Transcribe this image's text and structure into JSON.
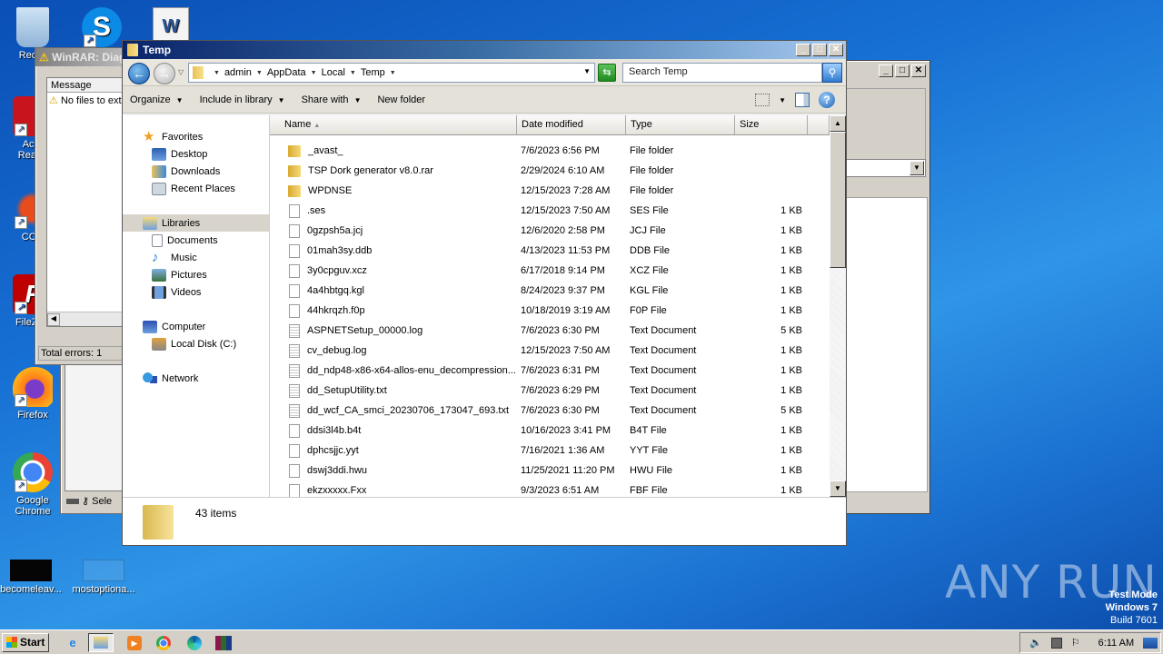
{
  "desktop": {
    "icons": [
      {
        "label": "Recycle Bin",
        "visible_label": "Recyc"
      },
      {
        "label": "Skype"
      },
      {
        "label": "Word Document"
      },
      {
        "label": "Acrobat Reader",
        "visible_label": "Acro\nReade"
      },
      {
        "label": "CCleaner",
        "visible_label": "CCle"
      },
      {
        "label": "FileZilla",
        "visible_label": "FileZilla"
      },
      {
        "label": "Firefox"
      },
      {
        "label": "Google Chrome"
      },
      {
        "label": "becomeleav..."
      },
      {
        "label": "mostoptiona..."
      }
    ],
    "watermark": "ANY RUN",
    "test_mode": {
      "line1": "Test Mode",
      "line2": "Windows 7",
      "line3": "Build 7601"
    }
  },
  "winrar_dialog": {
    "title": "WinRAR: Diagnostic messages",
    "visible_title": "WinRAR: Diag",
    "column_header": "Message",
    "messages": [
      {
        "icon": "warning-icon",
        "text": "No files to extract"
      }
    ],
    "status": "Total errors: 1"
  },
  "winrar_main": {
    "status_label": "Sele"
  },
  "explorer": {
    "title": "Temp",
    "breadcrumb": [
      "admin",
      "AppData",
      "Local",
      "Temp"
    ],
    "search_placeholder": "Search Temp",
    "toolbar": {
      "organize": "Organize",
      "include_in_library": "Include in library",
      "share_with": "Share with",
      "new_folder": "New folder"
    },
    "nav": {
      "favorites": {
        "label": "Favorites",
        "items": [
          "Desktop",
          "Downloads",
          "Recent Places"
        ]
      },
      "libraries": {
        "label": "Libraries",
        "items": [
          "Documents",
          "Music",
          "Pictures",
          "Videos"
        ]
      },
      "computer": {
        "label": "Computer",
        "items": [
          "Local Disk (C:)"
        ]
      },
      "network": {
        "label": "Network"
      }
    },
    "columns": {
      "name": "Name",
      "date": "Date modified",
      "type": "Type",
      "size": "Size"
    },
    "files": [
      {
        "name": "_avast_",
        "date": "7/6/2023 6:56 PM",
        "type": "File folder",
        "size": "",
        "kind": "folder"
      },
      {
        "name": "TSP Dork generator v8.0.rar",
        "date": "2/29/2024 6:10 AM",
        "type": "File folder",
        "size": "",
        "kind": "folder"
      },
      {
        "name": "WPDNSE",
        "date": "12/15/2023 7:28 AM",
        "type": "File folder",
        "size": "",
        "kind": "folder"
      },
      {
        "name": ".ses",
        "date": "12/15/2023 7:50 AM",
        "type": "SES File",
        "size": "1 KB",
        "kind": "file"
      },
      {
        "name": "0gzpsh5a.jcj",
        "date": "12/6/2020 2:58 PM",
        "type": "JCJ File",
        "size": "1 KB",
        "kind": "file"
      },
      {
        "name": "01mah3sy.ddb",
        "date": "4/13/2023 11:53 PM",
        "type": "DDB File",
        "size": "1 KB",
        "kind": "file"
      },
      {
        "name": "3y0cpguv.xcz",
        "date": "6/17/2018 9:14 PM",
        "type": "XCZ File",
        "size": "1 KB",
        "kind": "file"
      },
      {
        "name": "4a4hbtgq.kgl",
        "date": "8/24/2023 9:37 PM",
        "type": "KGL File",
        "size": "1 KB",
        "kind": "file"
      },
      {
        "name": "44hkrqzh.f0p",
        "date": "10/18/2019 3:19 AM",
        "type": "F0P File",
        "size": "1 KB",
        "kind": "file"
      },
      {
        "name": "ASPNETSetup_00000.log",
        "date": "7/6/2023 6:30 PM",
        "type": "Text Document",
        "size": "5 KB",
        "kind": "text"
      },
      {
        "name": "cv_debug.log",
        "date": "12/15/2023 7:50 AM",
        "type": "Text Document",
        "size": "1 KB",
        "kind": "text"
      },
      {
        "name": "dd_ndp48-x86-x64-allos-enu_decompression...",
        "date": "7/6/2023 6:31 PM",
        "type": "Text Document",
        "size": "1 KB",
        "kind": "text"
      },
      {
        "name": "dd_SetupUtility.txt",
        "date": "7/6/2023 6:29 PM",
        "type": "Text Document",
        "size": "1 KB",
        "kind": "text"
      },
      {
        "name": "dd_wcf_CA_smci_20230706_173047_693.txt",
        "date": "7/6/2023 6:30 PM",
        "type": "Text Document",
        "size": "5 KB",
        "kind": "text"
      },
      {
        "name": "ddsi3l4b.b4t",
        "date": "10/16/2023 3:41 PM",
        "type": "B4T File",
        "size": "1 KB",
        "kind": "file"
      },
      {
        "name": "dphcsjjc.yyt",
        "date": "7/16/2021 1:36 AM",
        "type": "YYT File",
        "size": "1 KB",
        "kind": "file"
      },
      {
        "name": "dswj3ddi.hwu",
        "date": "11/25/2021 11:20 PM",
        "type": "HWU File",
        "size": "1 KB",
        "kind": "file"
      },
      {
        "name": "ekzxxxxx.Fxx",
        "date": "9/3/2023 6:51 AM",
        "type": "FBF File",
        "size": "1 KB",
        "kind": "file"
      }
    ],
    "item_count": "43 items"
  },
  "taskbar": {
    "start_label": "Start",
    "apps": [
      "Internet Explorer",
      "Windows Explorer",
      "Media Player",
      "Google Chrome",
      "Microsoft Edge",
      "WinRAR"
    ],
    "clock": "6:11 AM"
  }
}
